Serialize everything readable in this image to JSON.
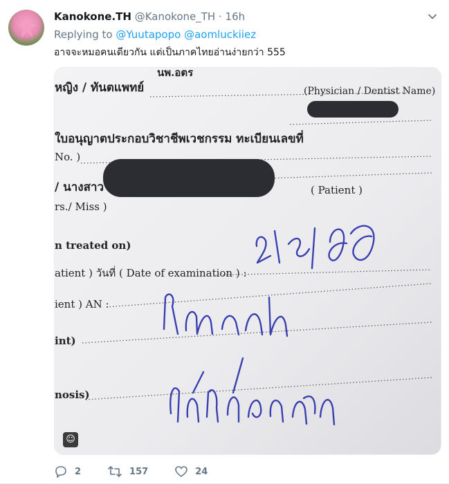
{
  "tweet": {
    "author_name": "Kanokone.TH",
    "author_handle": "@Kanokone_TH",
    "separator": "·",
    "timestamp": "16h",
    "replying_prefix": "Replying to",
    "replying_to": [
      "@Yuutapopo",
      "@aomluckiiez"
    ],
    "text": "อาจจะหมอคนเดียวกัน แต่เป็นภาคไทยอ่านง่ายกว่า 555"
  },
  "media": {
    "form_lines": {
      "line1": "หญิง / ทันตแพทย์",
      "line1b": "นพ.อตร",
      "line2": "(Physician / Dentist Name)",
      "line3": "ใบอนุญาตประกอบวิชาชีพเวชกรรม ทะเบียนเลขที่",
      "line4": "No. )",
      "line5": "/ นางสาว",
      "line6": "( Patient )",
      "line7": "rs./ Miss )",
      "line8": "n treated on)",
      "line9": "atient ) วันที่ ( Date of examination ) :",
      "line10": "ient ) AN :",
      "line11": "int)",
      "line12": "nosis)"
    },
    "sticker_icon": "smiley-icon"
  },
  "actions": {
    "replies": "2",
    "retweets": "157",
    "likes": "24"
  },
  "colors": {
    "accent": "#1da1f2",
    "secondary_text": "#657786",
    "ink": "#3a3fb0"
  }
}
